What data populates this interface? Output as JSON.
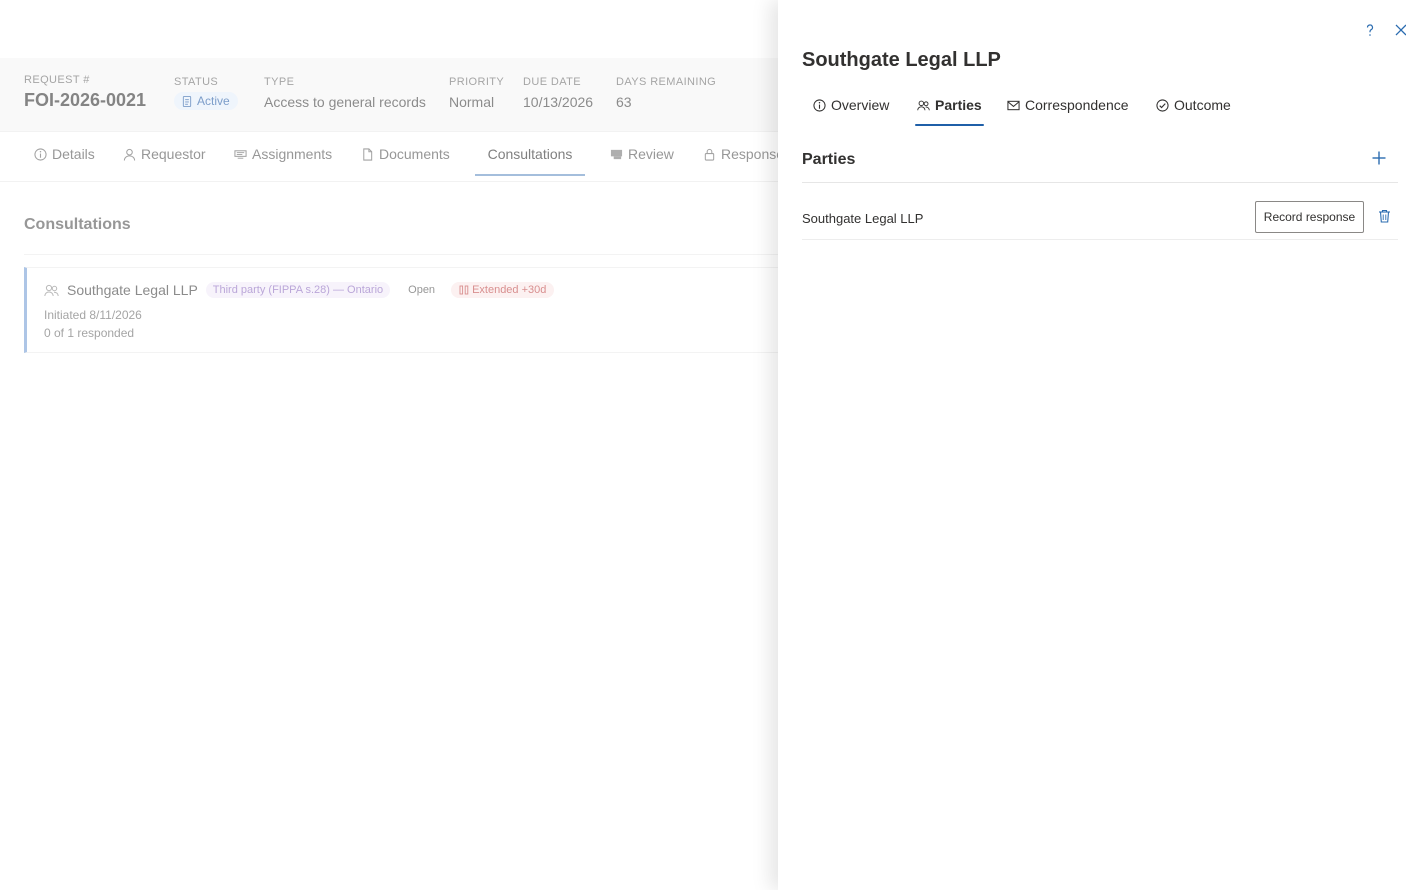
{
  "request_header": {
    "request_label": "REQUEST #",
    "request_number": "FOI-2026-0021",
    "status_label": "STATUS",
    "status_value": "Active",
    "type_label": "TYPE",
    "type_value": "Access to general records",
    "priority_label": "PRIORITY",
    "priority_value": "Normal",
    "due_label": "DUE DATE",
    "due_value": "10/13/2026",
    "days_label": "DAYS REMAINING",
    "days_value": "63"
  },
  "request_tabs": {
    "details": "Details",
    "requestor": "Requestor",
    "assignments": "Assignments",
    "documents": "Documents",
    "consultations": "Consultations",
    "review": "Review",
    "response": "Response"
  },
  "consultations": {
    "title": "Consultations",
    "card": {
      "name": "Southgate Legal LLP",
      "type_tag": "Third party (FIPPA s.28) — Ontario",
      "state": "Open",
      "extension": "Extended +30d",
      "initiated": "Initiated 8/11/2026",
      "responded": "0 of 1 responded"
    }
  },
  "panel": {
    "title": "Southgate Legal LLP",
    "tabs": {
      "overview": "Overview",
      "parties": "Parties",
      "correspondence": "Correspondence",
      "outcome": "Outcome"
    },
    "parties_title": "Parties",
    "party": {
      "name": "Southgate Legal LLP",
      "record_button": "Record response"
    }
  },
  "colors": {
    "accent": "#2b6cb0",
    "tab_underline": "#1f5fa8",
    "status_pill_bg": "#e7f0fb",
    "tag_purple": "#9a7cc6",
    "tag_red": "#c65a5a"
  },
  "icons": [
    "help-icon",
    "close-icon",
    "info-icon",
    "people-icon",
    "mail-icon",
    "check-circle-icon",
    "add-icon",
    "trash-icon",
    "document-icon",
    "person-icon",
    "assignment-icon",
    "review-icon",
    "lock-icon",
    "pause-icon"
  ]
}
